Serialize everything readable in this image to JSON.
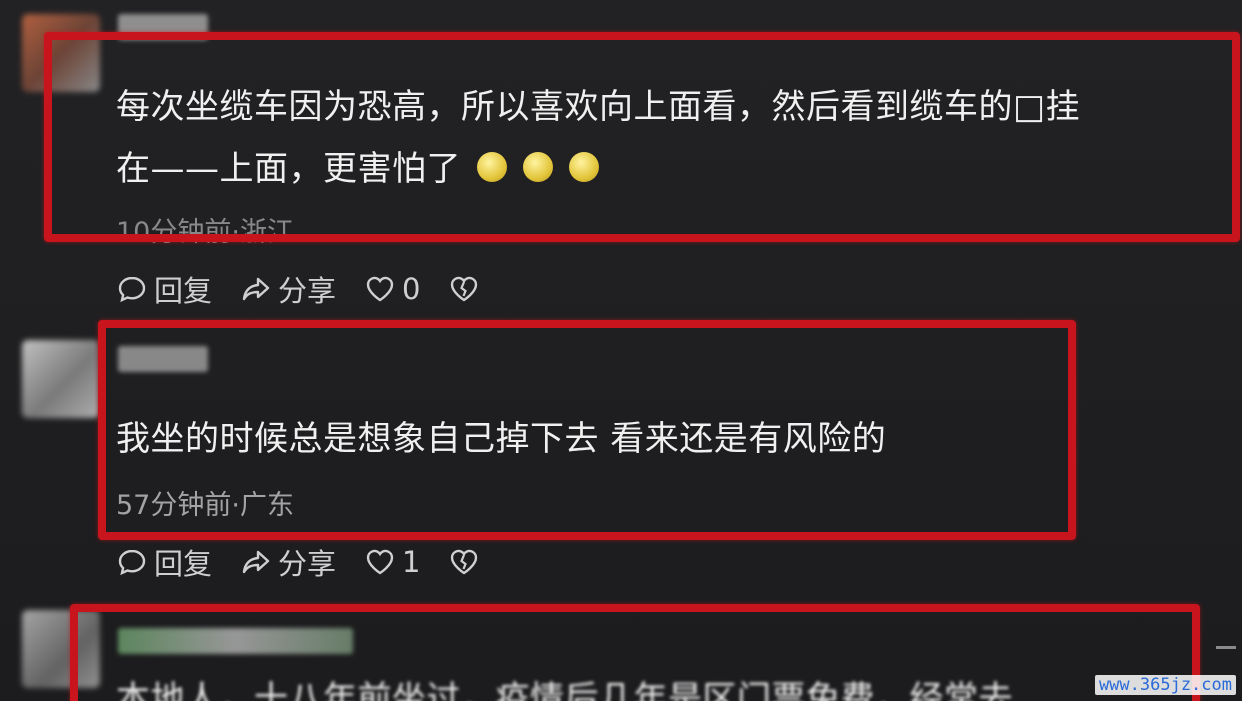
{
  "comments": [
    {
      "text_line1": "每次坐缆车因为恐高，所以喜欢向上面看，然后看到缆车的□挂",
      "text_line2": "在——上面，更害怕了",
      "meta": "10分钟前·浙江",
      "reply_label": "回复",
      "share_label": "分享",
      "like_count": "0"
    },
    {
      "text": "我坐的时候总是想象自己掉下去  看来还是有风险的",
      "meta": "57分钟前·广东",
      "reply_label": "回复",
      "share_label": "分享",
      "like_count": "1"
    },
    {
      "text": "本地人，十八年前坐过，疫情后几年是区门票免费，经常去"
    }
  ],
  "watermark": "www.365jz.com",
  "colors": {
    "annotation_red": "#c8141c",
    "background": "#1e1e20"
  }
}
